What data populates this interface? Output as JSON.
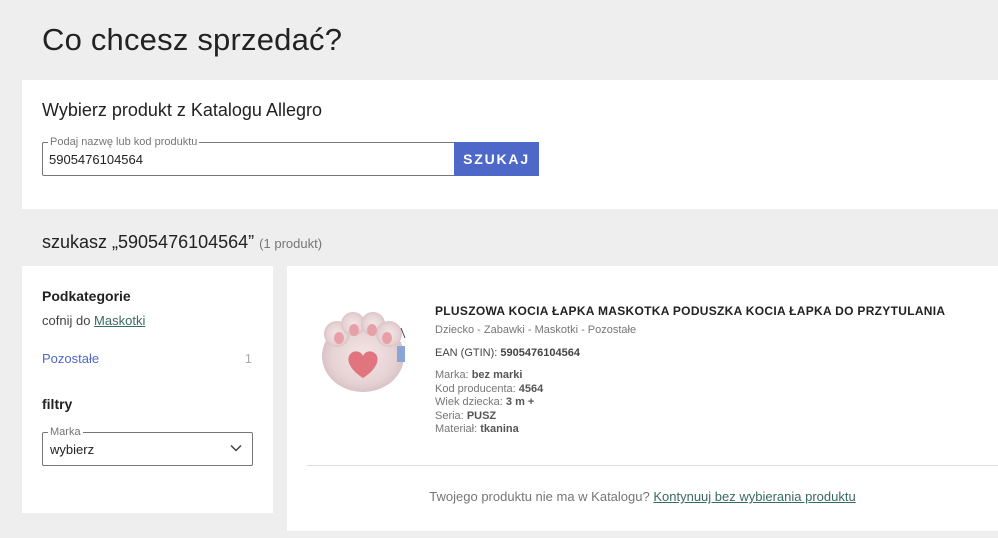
{
  "page": {
    "title": "Co chcesz sprzedać?"
  },
  "catalog_search": {
    "heading": "Wybierz produkt z Katalogu Allegro",
    "field_label": "Podaj nazwę lub kod produktu",
    "field_value": "5905476104564",
    "button_label": "SZUKAJ"
  },
  "results_header": {
    "query_text": "szukasz „5905476104564”",
    "count_text": "(1 produkt)"
  },
  "sidebar": {
    "subcategories_heading": "Podkategorie",
    "back_prefix": "cofnij do",
    "back_link": "Maskotki",
    "subcategory": {
      "label": "Pozostałe",
      "count": "1"
    },
    "filters_heading": "filtry",
    "brand_filter": {
      "label": "Marka",
      "value": "wybierz"
    }
  },
  "product": {
    "title": "PLUSZOWA KOCIA ŁAPKA MASKOTKA PODUSZKA KOCIA ŁAPKA DO PRZYTULANIA",
    "category_path": "Dziecko - Zabawki - Maskotki - Pozostałe",
    "ean_label": "EAN (GTIN):",
    "ean_value": "5905476104564",
    "attributes": [
      {
        "label": "Marka:",
        "value": "bez marki"
      },
      {
        "label": "Kod producenta:",
        "value": "4564"
      },
      {
        "label": "Wiek dziecka:",
        "value": "3 m +"
      },
      {
        "label": "Seria:",
        "value": "PUSZ"
      },
      {
        "label": "Materiał:",
        "value": "tkanina"
      }
    ]
  },
  "footer": {
    "question": "Twojego produktu nie ma w Katalogu?",
    "link": "Kontynuuj bez wybierania produktu"
  },
  "colors": {
    "accent": "#4e68c9",
    "link": "#386a5f",
    "background": "#eeeeee"
  }
}
